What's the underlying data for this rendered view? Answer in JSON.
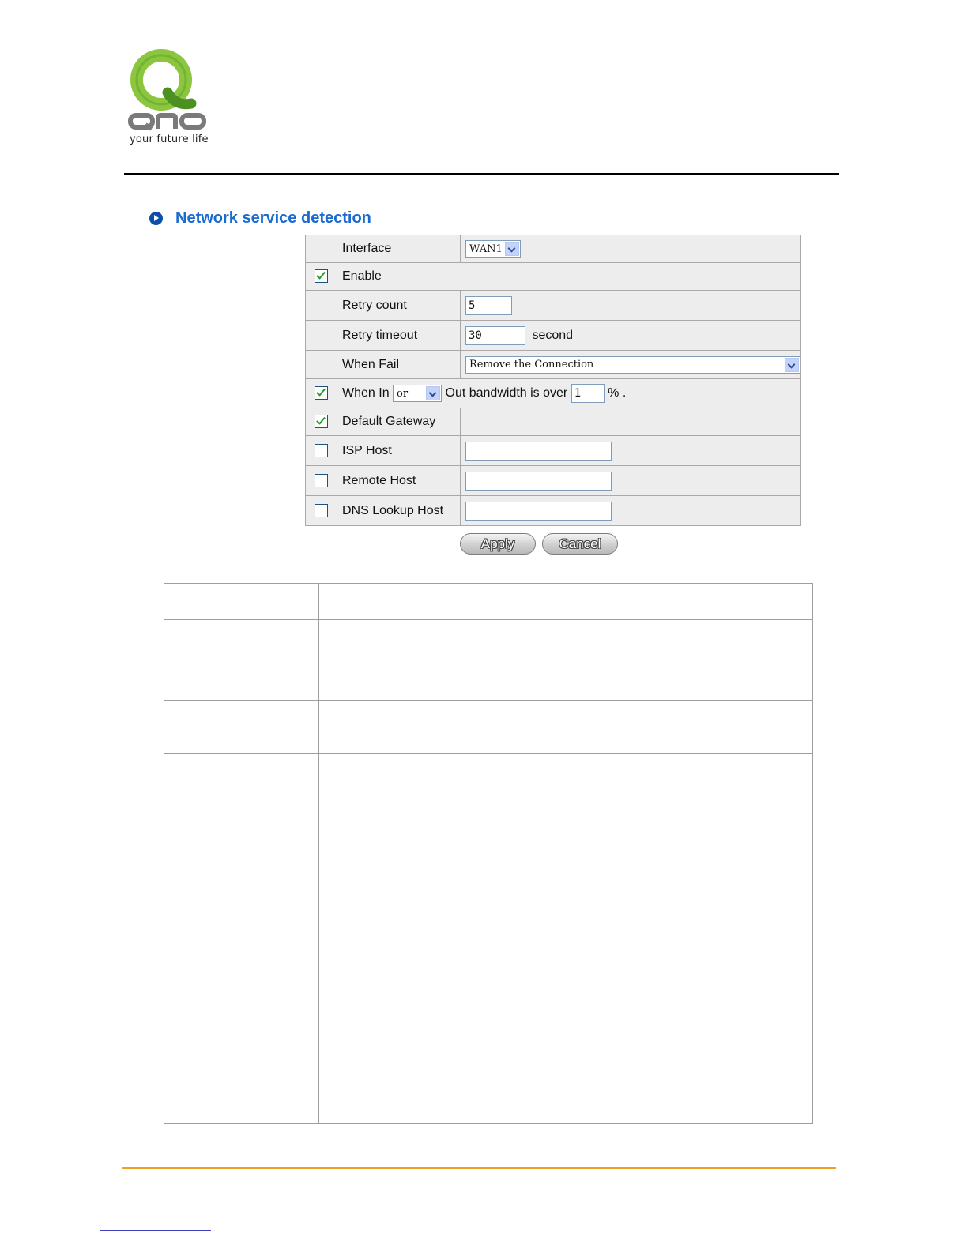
{
  "brand": {
    "tagline": "your future life",
    "colors": {
      "q_green": "#8cc63f",
      "q_dark": "#3b7a1a",
      "text_gray": "#7a7a7a",
      "accent_orange": "#f0a020",
      "title_blue": "#1a6ad0"
    }
  },
  "section": {
    "title": "Network service detection",
    "icon": "circle-arrow-icon"
  },
  "form": {
    "interface": {
      "label": "Interface",
      "value": "WAN1"
    },
    "enable": {
      "label": "Enable",
      "checked": true
    },
    "retry_count": {
      "label": "Retry count",
      "value": "5"
    },
    "retry_timeout": {
      "label": "Retry timeout",
      "value": "30",
      "unit": "second"
    },
    "when_fail": {
      "label": "When Fail",
      "value": "Remove the Connection"
    },
    "bandwidth": {
      "checked": true,
      "prefix": "When In",
      "operator": "or",
      "middle": "Out bandwidth is over",
      "value": "1",
      "suffix": "% ."
    },
    "default_gateway": {
      "label": "Default Gateway",
      "checked": true
    },
    "isp_host": {
      "label": "ISP Host",
      "checked": false,
      "value": ""
    },
    "remote_host": {
      "label": "Remote Host",
      "checked": false,
      "value": ""
    },
    "dns_lookup_host": {
      "label": "DNS Lookup Host",
      "checked": false,
      "value": ""
    }
  },
  "buttons": {
    "apply": "Apply",
    "cancel": "Cancel"
  }
}
